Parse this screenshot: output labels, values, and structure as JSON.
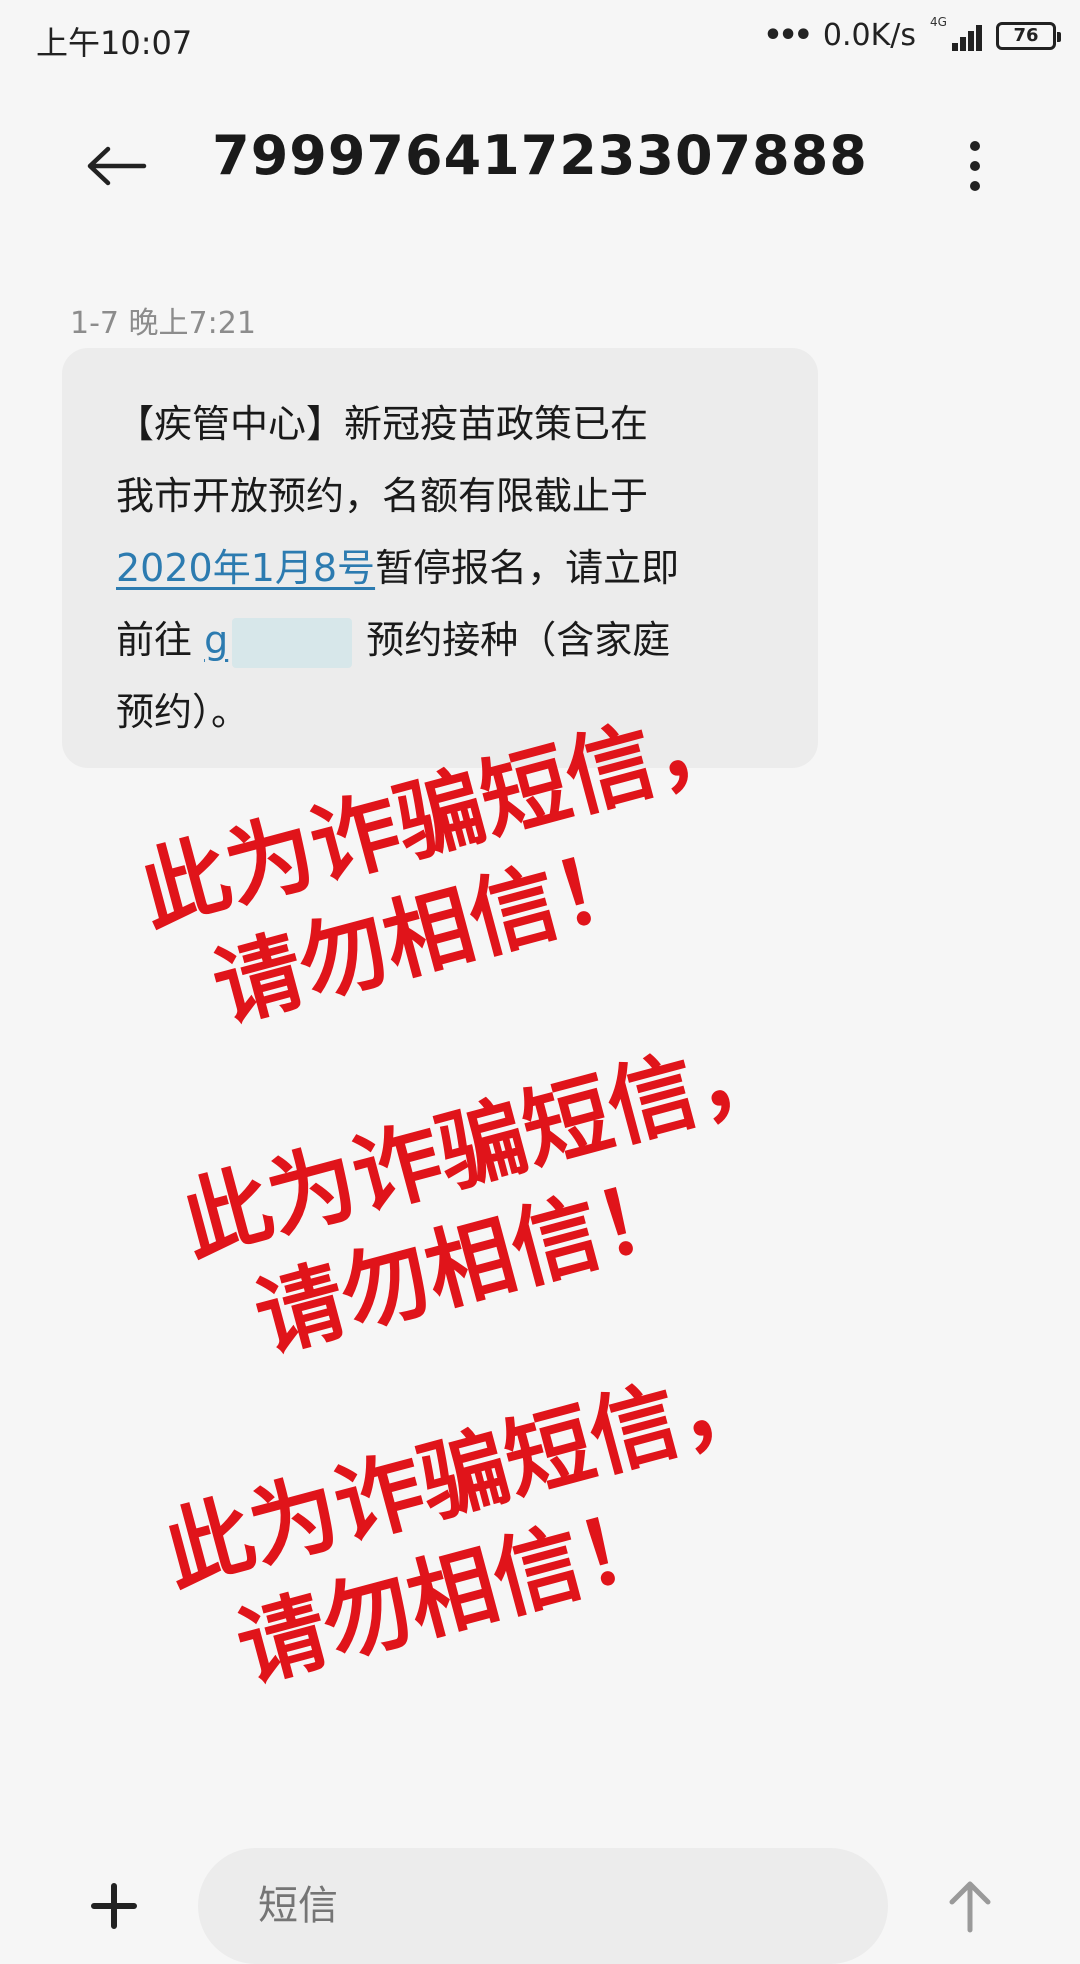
{
  "status_bar": {
    "time": "上午10:07",
    "dots": "•••",
    "net_speed": "0.0K/s",
    "network_type": "4G",
    "battery": "76"
  },
  "header": {
    "title": "79997641723307888",
    "back_icon": "arrow-left-icon",
    "menu_icon": "more-vertical-icon"
  },
  "message": {
    "timestamp": "1-7 晚上7:21",
    "line1": "【疾管中心】新冠疫苗政策已在",
    "line2": "我市开放预约，名额有限截止于",
    "date_link": "2020年1月8号",
    "line3_rest": "暂停报名，请立即",
    "line4_prefix": "前往 ",
    "url_fragment": "g",
    "line4_rest": "预约接种（含家庭",
    "line5": "预约）。"
  },
  "warnings": [
    {
      "line1": "此为诈骗短信，",
      "line2": "请勿相信！"
    },
    {
      "line1": "此为诈骗短信，",
      "line2": "请勿相信！"
    },
    {
      "line1": "此为诈骗短信，",
      "line2": "请勿相信！"
    }
  ],
  "input_bar": {
    "placeholder": "短信",
    "add_icon": "plus-icon",
    "send_icon": "arrow-up-icon"
  },
  "colors": {
    "background": "#f6f6f6",
    "bubble": "#ececec",
    "link": "#2c7bb0",
    "warning": "#e0141a"
  }
}
